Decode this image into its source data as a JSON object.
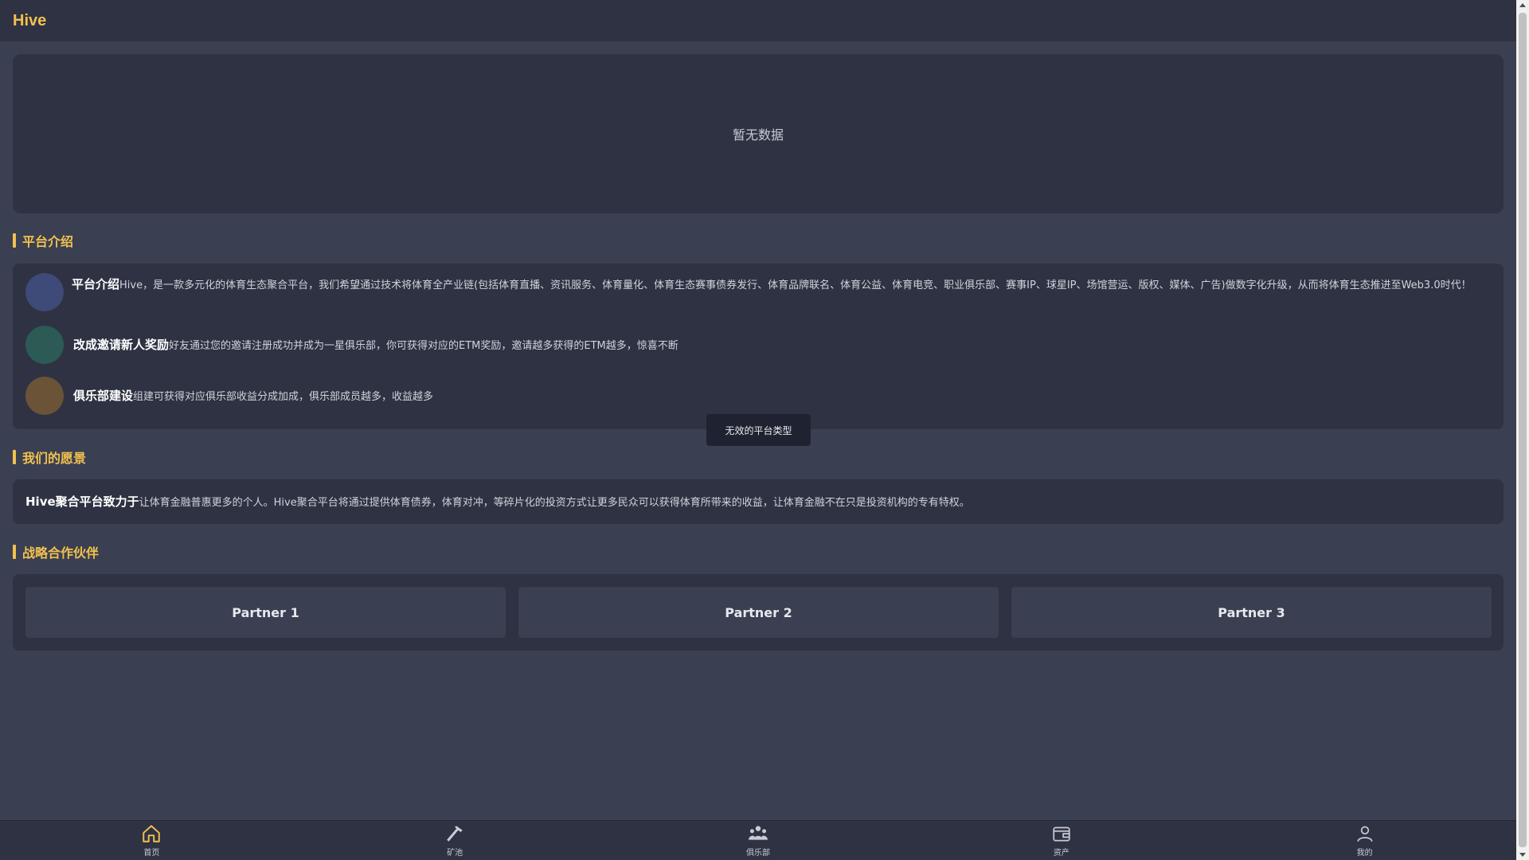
{
  "header": {
    "brand": "Hive"
  },
  "banner": {
    "empty_text": "暂无数据"
  },
  "sections": {
    "intro_title": "平台介绍",
    "vision_title": "我们的愿景",
    "partners_title": "战略合作伙伴"
  },
  "intro": {
    "items": [
      {
        "title": "平台介绍",
        "text": "Hive，是一款多元化的体育生态聚合平台，我们希望通过技术将体育全产业链(包括体育直播、资讯服务、体育量化、体育生态赛事债券发行、体育品牌联名、体育公益、体育电竞、职业俱乐部、赛事IP、球星IP、场馆营运、版权、媒体、广告)做数字化升级，从而将体育生态推进至Web3.0时代！",
        "avatar_color": "#3e4a78"
      },
      {
        "title": "改成邀请新人奖励",
        "text": "好友通过您的邀请注册成功并成为一星俱乐部，你可获得对应的ETM奖励，邀请越多获得的ETM越多，惊喜不断",
        "avatar_color": "#2c5a55"
      },
      {
        "title": "俱乐部建设",
        "text": "组建可获得对应俱乐部收益分成加成，俱乐部成员越多，收益越多",
        "avatar_color": "#6b5338"
      }
    ]
  },
  "vision": {
    "title": "Hive聚合平台致力于",
    "text": "让体育金融普惠更多的个人。Hive聚合平台将通过提供体育债券，体育对冲，等碎片化的投资方式让更多民众可以获得体育所带来的收益，让体育金融不在只是投资机构的专有特权。"
  },
  "partners": [
    "Partner 1",
    "Partner 2",
    "Partner 3"
  ],
  "toast": "无效的平台类型",
  "tabbar": {
    "tabs": [
      {
        "label": "首页",
        "icon": "home-icon"
      },
      {
        "label": "矿池",
        "icon": "hammer-icon"
      },
      {
        "label": "俱乐部",
        "icon": "group-icon"
      },
      {
        "label": "资产",
        "icon": "wallet-icon"
      },
      {
        "label": "我的",
        "icon": "user-icon"
      }
    ]
  },
  "colors": {
    "accent": "#f2c14e",
    "background": "#3a3f52",
    "card": "#2e3242"
  }
}
